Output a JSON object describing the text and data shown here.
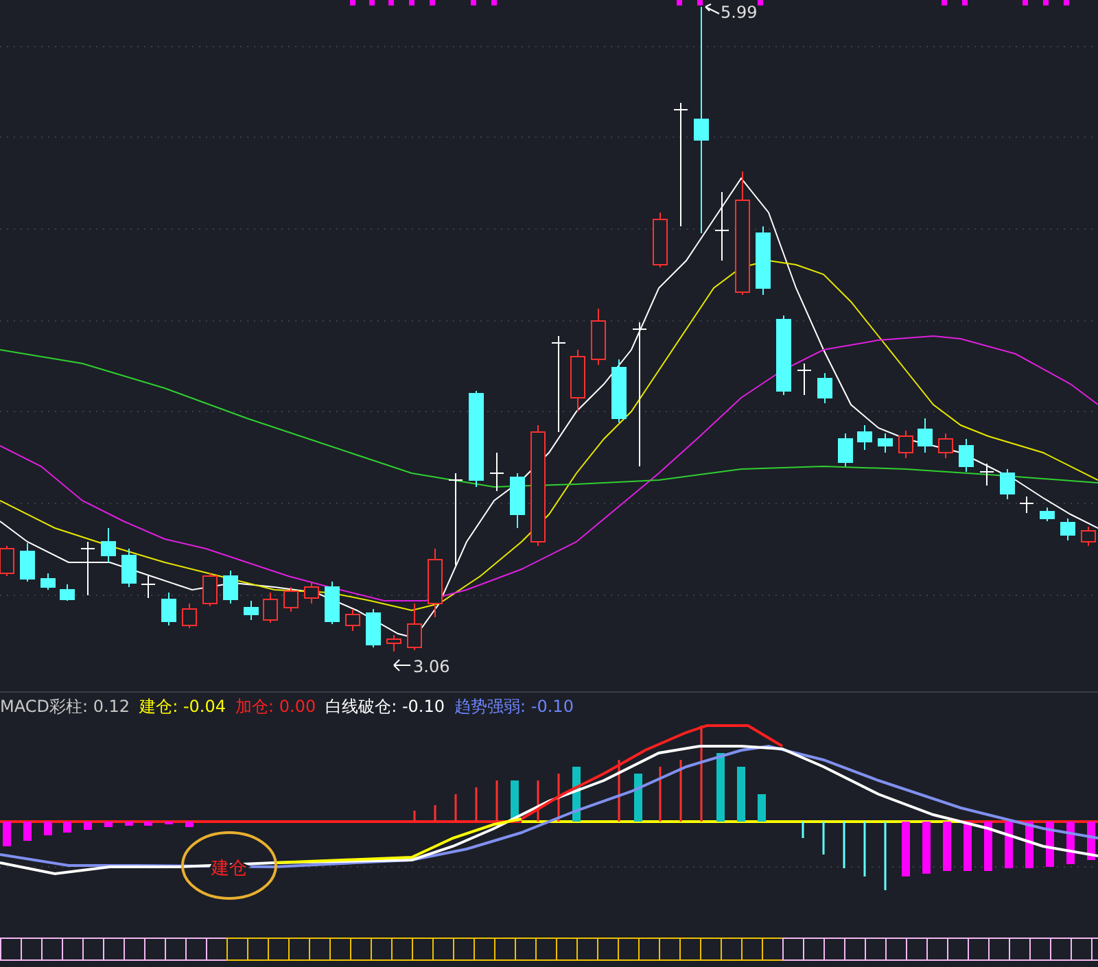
{
  "price_chart": {
    "high_label": "5.99",
    "low_label": "3.06"
  },
  "indicator_legend": [
    {
      "label": "MACD彩柱:",
      "value": "0.12",
      "color": "#c8c8c8"
    },
    {
      "label": "建仓:",
      "value": "-0.04",
      "color": "#ffff00"
    },
    {
      "label": "加仓:",
      "value": "0.00",
      "color": "#ff2020"
    },
    {
      "label": "白线破仓:",
      "value": "-0.10",
      "color": "#ffffff"
    },
    {
      "label": "趋势强弱:",
      "value": "-0.10",
      "color": "#6f86ff"
    }
  ],
  "macd_chart": {
    "annotation": "建仓"
  }
}
